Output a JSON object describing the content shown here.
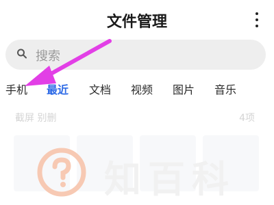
{
  "header": {
    "title": "文件管理",
    "more_icon": "more-vertical-icon"
  },
  "search": {
    "placeholder": "搜索",
    "icon": "search-icon"
  },
  "tabs": [
    {
      "label": "手机",
      "active": false
    },
    {
      "label": "最近",
      "active": true
    },
    {
      "label": "文档",
      "active": false
    },
    {
      "label": "视频",
      "active": false
    },
    {
      "label": "图片",
      "active": false
    },
    {
      "label": "音乐",
      "active": false
    }
  ],
  "recent": {
    "title": "截屏 别删",
    "count": "4项"
  },
  "watermark": {
    "text": "知百科"
  },
  "colors": {
    "accent": "#2d6ae6",
    "annotation_arrow": "#e23fe6",
    "search_bg": "#eeeeee",
    "watermark_logo": "#f7c9b3"
  }
}
